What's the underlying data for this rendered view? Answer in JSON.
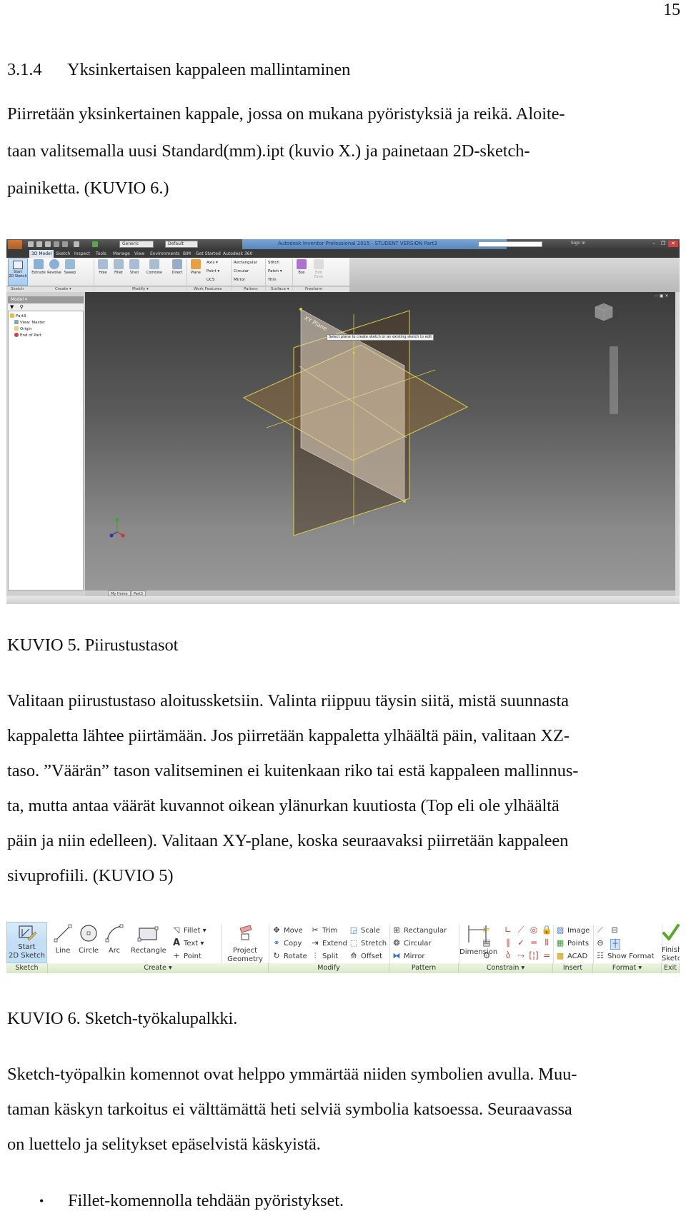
{
  "page_number": "15",
  "section": {
    "number": "3.1.4",
    "title": "Yksinkertaisen kappaleen mallintaminen"
  },
  "intro_paragraph": {
    "lines": [
      "Piirretään yksinkertainen kappale, jossa on mukana pyöristyksiä ja reikä. Aloite-",
      "taan valitsemalla uusi Standard(mm).ipt (kuvio X.) ja painetaan 2D-sketch-",
      "painiketta. (KUVIO 6.)"
    ]
  },
  "figure5": {
    "caption": "KUVIO 5. Piirustustasot",
    "app": {
      "window_title": "Autodesk Inventor Professional 2015 - STUDENT VERSION   Part3",
      "material_combo": "Generic",
      "appearance_combo": "Default",
      "sign_in": "Sign In",
      "window_controls": {
        "minimize": "–",
        "restore": "❐",
        "close": "✕"
      },
      "tabs": [
        "3D Model",
        "Sketch",
        "Inspect",
        "Tools",
        "Manage",
        "View",
        "Environments",
        "BIM",
        "Get Started",
        "Autodesk 360"
      ],
      "active_tab": "3D Model",
      "ribbon": {
        "sketch": {
          "title": "Sketch",
          "start_label_1": "Start",
          "start_label_2": "2D Sketch"
        },
        "create": {
          "title": "Create ▾",
          "tools": [
            "Extrude",
            "Revolve",
            "Sweep"
          ]
        },
        "modify": {
          "title": "Modify ▾",
          "tools": [
            "Hole",
            "Fillet",
            "Shell",
            "Combine",
            "Direct"
          ]
        },
        "work_features": {
          "title": "Work Features",
          "plane": "Plane",
          "axis": "Axis ▾",
          "point": "Point ▾",
          "ucs": "UCS"
        },
        "pattern": {
          "title": "Pattern",
          "items": [
            "Rectangular",
            "Circular",
            "Mirror"
          ]
        },
        "surface": {
          "title": "Surface ▾",
          "items": [
            "Stitch",
            "Patch ▾",
            "Trim"
          ]
        },
        "freeform": {
          "title": "Freeform",
          "box": "Box",
          "edit_form": "Edit Form"
        }
      },
      "browser": {
        "title": "Model ▾",
        "tree": [
          "Part3",
          "View: Master",
          "Origin",
          "End of Part"
        ]
      },
      "viewport": {
        "plane_label": "XY Plane",
        "tooltip": "Select plane to create sketch or an existing sketch to edit",
        "triad": {
          "x": "X",
          "y": "Y",
          "z": "Z"
        }
      },
      "doc_tabs": [
        "My Home",
        "Part3"
      ]
    }
  },
  "paragraph2": {
    "lines": [
      "Valitaan piirustustaso aloitussketsiin. Valinta riippuu täysin siitä, mistä suunnasta",
      "kappaletta lähtee piirtämään. Jos piirretään kappaletta ylhäältä päin, valitaan XZ-",
      "taso. ”Väärän” tason valitseminen ei kuitenkaan riko tai estä kappaleen mallinnus-",
      "ta, mutta antaa väärät kuvannot oikean ylänurkan kuutiosta (Top eli ole ylhäältä",
      "päin ja niin edelleen). Valitaan XY-plane, koska seuraavaksi piirretään kappaleen",
      "sivuprofiili. (KUVIO 5)"
    ]
  },
  "figure6": {
    "caption": "KUVIO 6. Sketch-työkalupalkki.",
    "toolbar": {
      "sketch": {
        "title": "Sketch",
        "start_label_1": "Start",
        "start_label_2": "2D Sketch"
      },
      "create": {
        "title": "Create ▾",
        "big_tools": [
          "Line",
          "Circle",
          "Arc",
          "Rectangle"
        ],
        "small_tools": [
          "Fillet ▾",
          "Text ▾",
          "Point"
        ],
        "project_1": "Project",
        "project_2": "Geometry"
      },
      "modify": {
        "title": "Modify",
        "col1": [
          "Move",
          "Copy",
          "Rotate"
        ],
        "col2": [
          "Trim",
          "Extend",
          "Split"
        ],
        "col3": [
          "Scale",
          "Stretch",
          "Offset"
        ]
      },
      "pattern": {
        "title": "Pattern",
        "items": [
          "Rectangular",
          "Circular",
          "Mirror"
        ]
      },
      "constrain": {
        "title": "Constrain ▾",
        "dimension": "Dimension"
      },
      "insert": {
        "title": "Insert",
        "items": [
          "Image",
          "Points",
          "ACAD"
        ]
      },
      "format": {
        "title": "Format ▾",
        "show_format": "Show Format"
      },
      "exit": {
        "title": "Exit",
        "finish_1": "Finish",
        "finish_2": "Sketch"
      }
    }
  },
  "paragraph3": {
    "lines": [
      "Sketch-työpalkin komennot ovat helppo ymmärtää niiden symbolien avulla. Muu-",
      "taman käskyn tarkoitus ei välttämättä heti selviä symbolia katsoessa. Seuraavassa",
      "on luettelo ja selitykset epäselvistä käskyistä."
    ]
  },
  "bullets": [
    "Fillet-komennolla tehdään pyöristykset."
  ],
  "colors": {
    "ribbon_group_green": "#d9e8c6",
    "start_sketch_blue": "#c4def5",
    "finish_check_green": "#5aa82a",
    "inventor_title_blue": "#6a96c8",
    "plane_outline_yellow": "#d8d050"
  }
}
